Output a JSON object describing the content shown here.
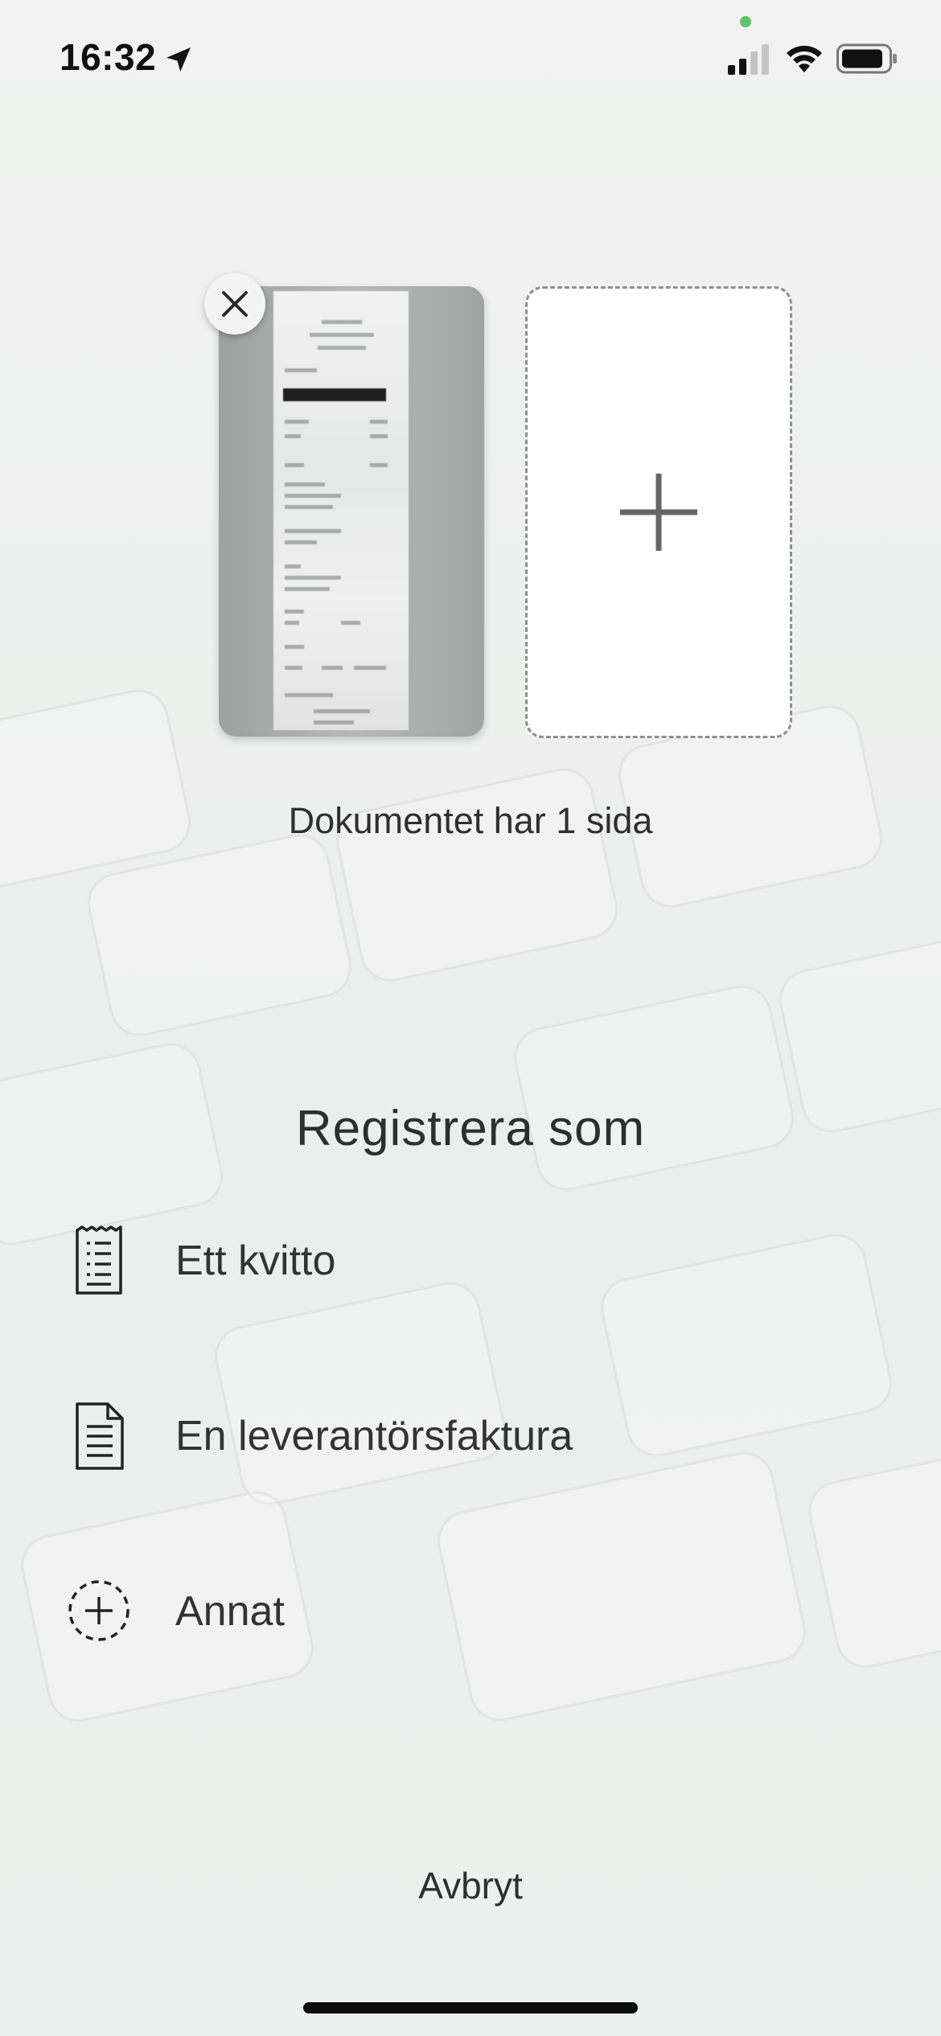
{
  "status_bar": {
    "time": "16:32",
    "icons": [
      "location-arrow-icon",
      "signal-icon",
      "wifi-icon",
      "battery-icon"
    ]
  },
  "pages": {
    "thumbnails": [
      {
        "label": "page-1",
        "icon": "receipt-photo"
      }
    ],
    "remove_icon": "close-icon",
    "add_icon": "plus-icon",
    "count_text": "Dokumentet har 1 sida"
  },
  "register": {
    "title": "Registrera som",
    "options": [
      {
        "label": "Ett kvitto",
        "icon": "receipt-icon"
      },
      {
        "label": "En leverantörsfaktura",
        "icon": "document-icon"
      },
      {
        "label": "Annat",
        "icon": "dashed-plus-circle-icon"
      }
    ]
  },
  "footer": {
    "cancel_label": "Avbryt"
  },
  "colors": {
    "background": "#eef0ef",
    "text": "#2f2f2f",
    "recording_dot": "#5cc46b"
  }
}
